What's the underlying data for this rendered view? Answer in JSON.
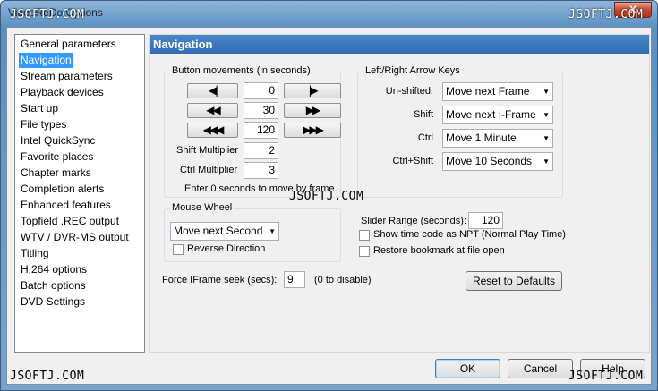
{
  "window": {
    "title": "VideoReDo Options",
    "close_glyph": "X"
  },
  "watermark": "JSOFTJ.COM",
  "nav": {
    "items": [
      "General parameters",
      "Navigation",
      "Stream parameters",
      "Playback devices",
      "Start up",
      "File types",
      "Intel QuickSync",
      "Favorite places",
      "Chapter marks",
      "Completion alerts",
      "Enhanced features",
      "Topfield .REC output",
      "WTV / DVR-MS output",
      "Titling",
      "H.264 options",
      "Batch options",
      "DVD Settings"
    ],
    "selected": "Navigation"
  },
  "panel": {
    "title": "Navigation"
  },
  "button_movements": {
    "label": "Button movements (in seconds)",
    "rows": [
      {
        "left_glyph": "◀|",
        "value": "0",
        "right_glyph": "|▶"
      },
      {
        "left_glyph": "◀◀",
        "value": "30",
        "right_glyph": "▶▶"
      },
      {
        "left_glyph": "◀◀◀",
        "value": "120",
        "right_glyph": "▶▶▶"
      }
    ],
    "shift_multiplier_label": "Shift Multiplier",
    "shift_multiplier": "2",
    "ctrl_multiplier_label": "Ctrl Multiplier",
    "ctrl_multiplier": "3",
    "hint": "Enter 0 seconds to move by frame."
  },
  "arrow_keys": {
    "label": "Left/Right Arrow Keys",
    "rows": [
      {
        "label": "Un-shifted:",
        "value": "Move next Frame"
      },
      {
        "label": "Shift",
        "value": "Move next I-Frame"
      },
      {
        "label": "Ctrl",
        "value": "Move 1 Minute"
      },
      {
        "label": "Ctrl+Shift",
        "value": "Move 10 Seconds"
      }
    ]
  },
  "mouse_wheel": {
    "label": "Mouse Wheel",
    "value": "Move next Second",
    "reverse_label": "Reverse Direction",
    "reverse_checked": false
  },
  "slider": {
    "label": "Slider Range (seconds):",
    "value": "120"
  },
  "show_npt": {
    "label": "Show time code as NPT (Normal Play Time)",
    "checked": false
  },
  "restore_bookmark": {
    "label": "Restore bookmark at file open",
    "checked": false
  },
  "iframe_seek": {
    "label": "Force IFrame seek (secs):",
    "value": "9",
    "hint": "(0 to disable)"
  },
  "buttons": {
    "reset": "Reset to Defaults",
    "ok": "OK",
    "cancel": "Cancel",
    "help": "Help"
  }
}
